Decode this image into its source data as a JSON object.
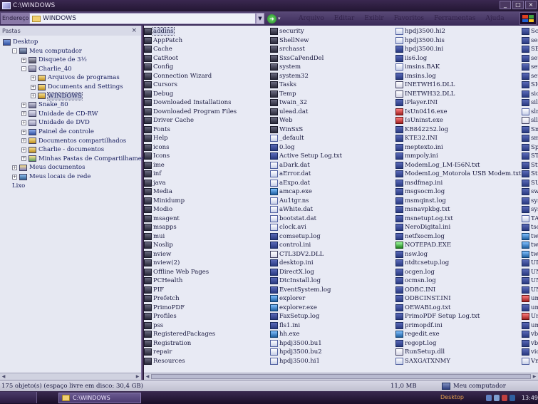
{
  "window": {
    "title": "C:\\WINDOWS"
  },
  "address_bar": {
    "label": "Endereço",
    "value": "WINDOWS",
    "go_label": "Ir"
  },
  "menu": [
    "Arquivo",
    "Editar",
    "Exibir",
    "Favoritos",
    "Ferramentas",
    "Ajuda"
  ],
  "folders_pane": {
    "title": "Pastas",
    "close": "×",
    "tree": [
      {
        "label": "Desktop",
        "level": 0,
        "pm": "",
        "icon": "desktop"
      },
      {
        "label": "Meu computador",
        "level": 1,
        "pm": "−",
        "icon": "computer"
      },
      {
        "label": "Disquete de 3½",
        "level": 2,
        "pm": "+",
        "icon": "floppy"
      },
      {
        "label": "Charlie_40",
        "level": 2,
        "pm": "−",
        "icon": "drive"
      },
      {
        "label": "Arquivos de programas",
        "level": 3,
        "pm": "+",
        "icon": "folder"
      },
      {
        "label": "Documents and Settings",
        "level": 3,
        "pm": "+",
        "icon": "folder"
      },
      {
        "label": "WINDOWS",
        "level": 3,
        "pm": "+",
        "icon": "folder",
        "selected": true
      },
      {
        "label": "Snake_80",
        "level": 2,
        "pm": "+",
        "icon": "drive"
      },
      {
        "label": "Unidade de CD-RW",
        "level": 2,
        "pm": "+",
        "icon": "cd"
      },
      {
        "label": "Unidade de DVD",
        "level": 2,
        "pm": "+",
        "icon": "cd"
      },
      {
        "label": "Painel de controle",
        "level": 2,
        "pm": "+",
        "icon": "control"
      },
      {
        "label": "Documentos compartilhados",
        "level": 2,
        "pm": "+",
        "icon": "folder"
      },
      {
        "label": "Charlie - documentos",
        "level": 2,
        "pm": "+",
        "icon": "folder"
      },
      {
        "label": "Minhas Pastas de Compartilhamento",
        "level": 2,
        "pm": "+",
        "icon": "share"
      },
      {
        "label": "Meus documentos",
        "level": 1,
        "pm": "+",
        "icon": "docs"
      },
      {
        "label": "Meus locais de rede",
        "level": 1,
        "pm": "+",
        "icon": "network"
      },
      {
        "label": "Lixo",
        "level": 1,
        "pm": "",
        "icon": "trash"
      }
    ]
  },
  "files": {
    "columns": [
      [
        {
          "n": "addins",
          "t": "folder",
          "sel": true
        },
        {
          "n": "AppPatch",
          "t": "folder"
        },
        {
          "n": "Cache",
          "t": "folder"
        },
        {
          "n": "CatRoot",
          "t": "folder"
        },
        {
          "n": "Config",
          "t": "folder"
        },
        {
          "n": "Connection Wizard",
          "t": "folder"
        },
        {
          "n": "Cursors",
          "t": "folder"
        },
        {
          "n": "Debug",
          "t": "folder"
        },
        {
          "n": "Downloaded Installations",
          "t": "folder"
        },
        {
          "n": "Downloaded Program Files",
          "t": "folder"
        },
        {
          "n": "Driver Cache",
          "t": "folder"
        },
        {
          "n": "Fonts",
          "t": "folder"
        },
        {
          "n": "Help",
          "t": "folder"
        },
        {
          "n": "icons",
          "t": "folder"
        },
        {
          "n": "Icons",
          "t": "folder"
        },
        {
          "n": "ime",
          "t": "folder"
        },
        {
          "n": "inf",
          "t": "folder"
        },
        {
          "n": "java",
          "t": "folder"
        },
        {
          "n": "Media",
          "t": "folder"
        },
        {
          "n": "Minidump",
          "t": "folder"
        },
        {
          "n": "Modio",
          "t": "folder"
        },
        {
          "n": "msagent",
          "t": "folder"
        },
        {
          "n": "msapps",
          "t": "folder"
        },
        {
          "n": "mui",
          "t": "folder"
        },
        {
          "n": "Noslip",
          "t": "folder"
        },
        {
          "n": "nview",
          "t": "folder"
        },
        {
          "n": "nview(2)",
          "t": "folder"
        },
        {
          "n": "Offline Web Pages",
          "t": "folder"
        },
        {
          "n": "PCHealth",
          "t": "folder"
        },
        {
          "n": "PIF",
          "t": "folder"
        },
        {
          "n": "Prefetch",
          "t": "folder"
        },
        {
          "n": "PrimoPDF",
          "t": "folder"
        },
        {
          "n": "Profiles",
          "t": "folder"
        },
        {
          "n": "pss",
          "t": "folder"
        },
        {
          "n": "RegisteredPackages",
          "t": "folder"
        },
        {
          "n": "Registration",
          "t": "folder"
        },
        {
          "n": "repair",
          "t": "folder"
        },
        {
          "n": "Resources",
          "t": "folder"
        }
      ],
      [
        {
          "n": "security",
          "t": "folder"
        },
        {
          "n": "ShellNew",
          "t": "folder"
        },
        {
          "n": "srchasst",
          "t": "folder"
        },
        {
          "n": "SxsCaPendDel",
          "t": "folder"
        },
        {
          "n": "system",
          "t": "folder"
        },
        {
          "n": "system32",
          "t": "folder"
        },
        {
          "n": "Tasks",
          "t": "folder"
        },
        {
          "n": "Temp",
          "t": "folder"
        },
        {
          "n": "twain_32",
          "t": "folder"
        },
        {
          "n": "ulead.dat",
          "t": "folder"
        },
        {
          "n": "Web",
          "t": "folder"
        },
        {
          "n": "WinSxS",
          "t": "folder"
        },
        {
          "n": "_default",
          "t": "doc"
        },
        {
          "n": "0.log",
          "t": "log"
        },
        {
          "n": "Active Setup Log.txt",
          "t": "log"
        },
        {
          "n": "aDark.dat",
          "t": "doc"
        },
        {
          "n": "aError.dat",
          "t": "doc"
        },
        {
          "n": "aExpo.dat",
          "t": "doc"
        },
        {
          "n": "amcap.exe",
          "t": "exe"
        },
        {
          "n": "Au1tgr.ns",
          "t": "doc"
        },
        {
          "n": "aWhite.dat",
          "t": "doc"
        },
        {
          "n": "bootstat.dat",
          "t": "doc"
        },
        {
          "n": "clock.avi",
          "t": "doc"
        },
        {
          "n": "comsetup.log",
          "t": "log"
        },
        {
          "n": "control.ini",
          "t": "log"
        },
        {
          "n": "CTL3DV2.DLL",
          "t": "dll"
        },
        {
          "n": "desktop.ini",
          "t": "log"
        },
        {
          "n": "DirectX.log",
          "t": "log"
        },
        {
          "n": "DtcInstall.log",
          "t": "log"
        },
        {
          "n": "EventSystem.log",
          "t": "log"
        },
        {
          "n": "explorer",
          "t": "exe"
        },
        {
          "n": "explorer.exe",
          "t": "exe"
        },
        {
          "n": "FaxSetup.log",
          "t": "log"
        },
        {
          "n": "fls1.ini",
          "t": "log"
        },
        {
          "n": "hh.exe",
          "t": "exe"
        },
        {
          "n": "hpdj3500.bu1",
          "t": "doc"
        },
        {
          "n": "hpdj3500.bu2",
          "t": "doc"
        },
        {
          "n": "hpdj3500.hi1",
          "t": "doc"
        }
      ],
      [
        {
          "n": "hpdj3500.hi2",
          "t": "doc"
        },
        {
          "n": "hpdj3500.his",
          "t": "doc"
        },
        {
          "n": "hpdj3500.ini",
          "t": "log"
        },
        {
          "n": "iis6.log",
          "t": "log"
        },
        {
          "n": "imsins.BAK",
          "t": "doc"
        },
        {
          "n": "imsins.log",
          "t": "log"
        },
        {
          "n": "INETWH16.DLL",
          "t": "dll"
        },
        {
          "n": "INETWH32.DLL",
          "t": "dll"
        },
        {
          "n": "iPlayer.INI",
          "t": "log"
        },
        {
          "n": "IsUn0416.exe",
          "t": "red"
        },
        {
          "n": "IsUninst.exe",
          "t": "red"
        },
        {
          "n": "KB842252.log",
          "t": "log"
        },
        {
          "n": "KTE32.INI",
          "t": "log"
        },
        {
          "n": "meptexto.ini",
          "t": "log"
        },
        {
          "n": "mmpoly.ini",
          "t": "log"
        },
        {
          "n": "ModemLog_LM-I56N.txt",
          "t": "log"
        },
        {
          "n": "ModemLog_Motorola USB Modem.txt",
          "t": "log"
        },
        {
          "n": "msdfmap.ini",
          "t": "log"
        },
        {
          "n": "msgsocm.log",
          "t": "log"
        },
        {
          "n": "msmqinst.log",
          "t": "log"
        },
        {
          "n": "msnavpkbg.txt",
          "t": "log"
        },
        {
          "n": "msnetupLog.txt",
          "t": "log"
        },
        {
          "n": "NeroDigital.ini",
          "t": "log"
        },
        {
          "n": "netfxocm.log",
          "t": "log"
        },
        {
          "n": "NOTEPAD.EXE",
          "t": "green"
        },
        {
          "n": "nsw.log",
          "t": "log"
        },
        {
          "n": "ntdtcsetup.log",
          "t": "log"
        },
        {
          "n": "ocgen.log",
          "t": "log"
        },
        {
          "n": "ocmsn.log",
          "t": "log"
        },
        {
          "n": "ODBC.INI",
          "t": "log"
        },
        {
          "n": "ODBCINST.INI",
          "t": "log"
        },
        {
          "n": "OEWABLog.txt",
          "t": "log"
        },
        {
          "n": "PrimoPDF Setup Log.txt",
          "t": "log"
        },
        {
          "n": "primopdf.ini",
          "t": "log"
        },
        {
          "n": "regedit.exe",
          "t": "exe"
        },
        {
          "n": "regopt.log",
          "t": "log"
        },
        {
          "n": "RunSetup.dll",
          "t": "dll"
        },
        {
          "n": "SAXGATXNMY",
          "t": "doc"
        }
      ],
      [
        {
          "n": "Sci",
          "t": "log"
        },
        {
          "n": "ses",
          "t": "log"
        },
        {
          "n": "SE",
          "t": "log"
        },
        {
          "n": "set",
          "t": "log"
        },
        {
          "n": "set",
          "t": "log"
        },
        {
          "n": "set",
          "t": "log"
        },
        {
          "n": "SIC",
          "t": "log"
        },
        {
          "n": "sic",
          "t": "log"
        },
        {
          "n": "sile",
          "t": "log"
        },
        {
          "n": "slr",
          "t": "doc"
        },
        {
          "n": "sllc",
          "t": "dll"
        },
        {
          "n": "Sm",
          "t": "log"
        },
        {
          "n": "sm",
          "t": "log"
        },
        {
          "n": "Sp",
          "t": "log"
        },
        {
          "n": "ST",
          "t": "log"
        },
        {
          "n": "Sti",
          "t": "log"
        },
        {
          "n": "Sti",
          "t": "log"
        },
        {
          "n": "SU",
          "t": "log"
        },
        {
          "n": "sw",
          "t": "log"
        },
        {
          "n": "sys",
          "t": "log"
        },
        {
          "n": "sys",
          "t": "log"
        },
        {
          "n": "TA",
          "t": "doc"
        },
        {
          "n": "tsc",
          "t": "log"
        },
        {
          "n": "tw",
          "t": "exe"
        },
        {
          "n": "tw",
          "t": "exe"
        },
        {
          "n": "tw",
          "t": "exe"
        },
        {
          "n": "UL",
          "t": "log"
        },
        {
          "n": "UN",
          "t": "log"
        },
        {
          "n": "UN",
          "t": "log"
        },
        {
          "n": "UN",
          "t": "log"
        },
        {
          "n": "un",
          "t": "red"
        },
        {
          "n": "un",
          "t": "log"
        },
        {
          "n": "Un",
          "t": "red"
        },
        {
          "n": "un",
          "t": "log"
        },
        {
          "n": "vb",
          "t": "log"
        },
        {
          "n": "vb",
          "t": "log"
        },
        {
          "n": "vic",
          "t": "log"
        },
        {
          "n": "Vn",
          "t": "doc"
        }
      ]
    ]
  },
  "status": {
    "objects": "175 objeto(s) (espaço livre em disco: 30,4 GB)",
    "size": "11,0 MB",
    "location": "Meu computador"
  },
  "taskbar": {
    "task_label": "C:\\WINDOWS",
    "desktop_label": "Desktop",
    "clock": "13:49"
  }
}
